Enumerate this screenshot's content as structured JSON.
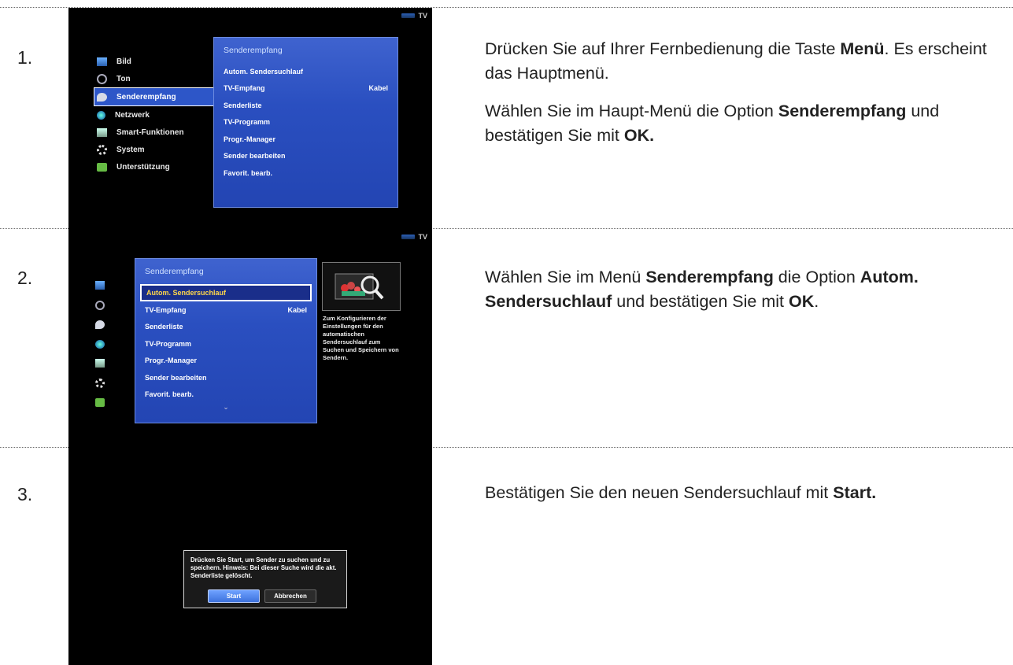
{
  "steps": [
    {
      "number": "1.",
      "paragraphs": [
        [
          {
            "t": "Drücken Sie auf Ihrer Fernbedienung die Taste "
          },
          {
            "t": "Menü",
            "b": true
          },
          {
            "t": ". Es erscheint das Hauptmenü."
          }
        ],
        [
          {
            "t": "Wählen Sie im Haupt-Menü die Option "
          },
          {
            "t": "Senderempfang",
            "b": true
          },
          {
            "t": " und bestätigen Sie mit "
          },
          {
            "t": "OK.",
            "b": true
          }
        ]
      ]
    },
    {
      "number": "2.",
      "paragraphs": [
        [
          {
            "t": "Wählen Sie im Menü "
          },
          {
            "t": "Senderempfang",
            "b": true
          },
          {
            "t": " die Option "
          },
          {
            "t": "Autom. Sendersuchlauf",
            "b": true
          },
          {
            "t": " und bestätigen Sie mit "
          },
          {
            "t": "OK",
            "b": true
          },
          {
            "t": "."
          }
        ]
      ]
    },
    {
      "number": "3.",
      "paragraphs": [
        [
          {
            "t": "Bestätigen Sie den neuen Sendersuchlauf mit "
          },
          {
            "t": "Start.",
            "b": true
          }
        ]
      ]
    }
  ],
  "tv_badge": "TV",
  "main_menu": [
    "Bild",
    "Ton",
    "Senderempfang",
    "Netzwerk",
    "Smart-Funktionen",
    "System",
    "Unterstützung"
  ],
  "submenu": {
    "title": "Senderempfang",
    "items": [
      "Autom. Sendersuchlauf",
      "TV-Empfang",
      "Senderliste",
      "TV-Programm",
      "Progr.-Manager",
      "Sender bearbeiten",
      "Favorit. bearb."
    ],
    "tv_empfang_value": "Kabel"
  },
  "info_text": "Zum Konfigurieren der Einstellungen für den automatischen Sendersuchlauf zum Suchen und Speichern von Sendern.",
  "dialog": {
    "text": "Drücken Sie Start, um Sender zu suchen und zu speichern. Hinweis: Bei dieser Suche wird die akt. Senderliste gelöscht.",
    "start": "Start",
    "cancel": "Abbrechen"
  },
  "colors": {
    "menu_blue": "#2d56c8",
    "panel_blue": "#2a4fc0",
    "rule": "#6a6a6a"
  }
}
